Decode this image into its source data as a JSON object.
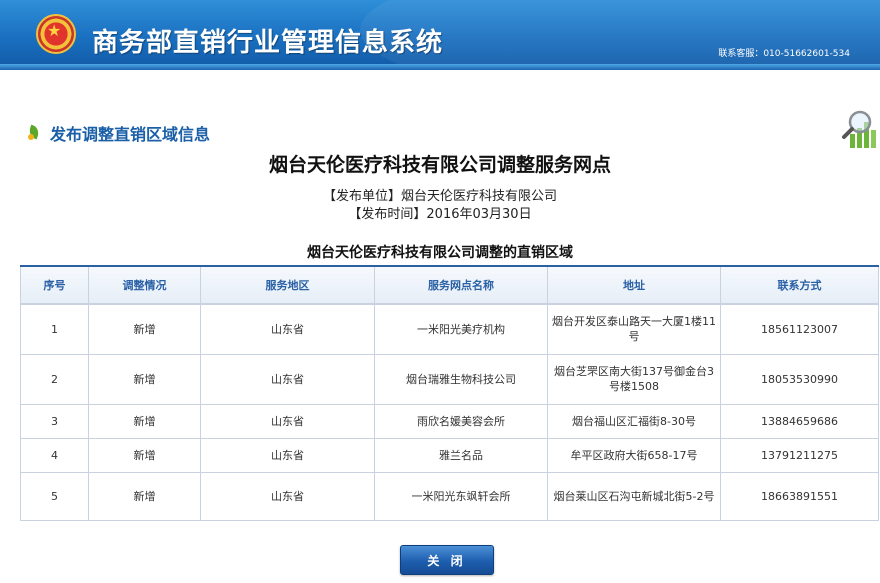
{
  "header": {
    "title": "商务部直销行业管理信息系统",
    "hotline": "联系客服：010-51662601-534"
  },
  "section": {
    "title": "发布调整直销区域信息"
  },
  "notice": {
    "title": "烟台天伦医疗科技有限公司调整服务网点",
    "publisher": "【发布单位】烟台天伦医疗科技有限公司",
    "publish_time": "【发布时间】2016年03月30日",
    "table_title": "烟台天伦医疗科技有限公司调整的直销区域"
  },
  "table": {
    "headers": [
      "序号",
      "调整情况",
      "服务地区",
      "服务网点名称",
      "地址",
      "联系方式"
    ],
    "rows": [
      [
        "1",
        "新增",
        "山东省",
        "一米阳光美疗机构",
        "烟台开发区泰山路天一大厦1楼11号",
        "18561123007"
      ],
      [
        "2",
        "新增",
        "山东省",
        "烟台瑞雅生物科技公司",
        "烟台芝罘区南大街137号御金台3号楼1508",
        "18053530990"
      ],
      [
        "3",
        "新增",
        "山东省",
        "雨欣名媛美容会所",
        "烟台福山区汇福街8-30号",
        "13884659686"
      ],
      [
        "4",
        "新增",
        "山东省",
        "雅兰名品",
        "牟平区政府大街658-17号",
        "13791211275"
      ],
      [
        "5",
        "新增",
        "山东省",
        "一米阳光东飒轩会所",
        "烟台莱山区石沟屯新城北街5-2号",
        "18663891551"
      ]
    ]
  },
  "footer": {
    "close_label": "关 闭"
  },
  "colors": {
    "header_blue": "#1a6fc0",
    "link_blue": "#1a5fa8",
    "table_header_text": "#2a60a6"
  }
}
